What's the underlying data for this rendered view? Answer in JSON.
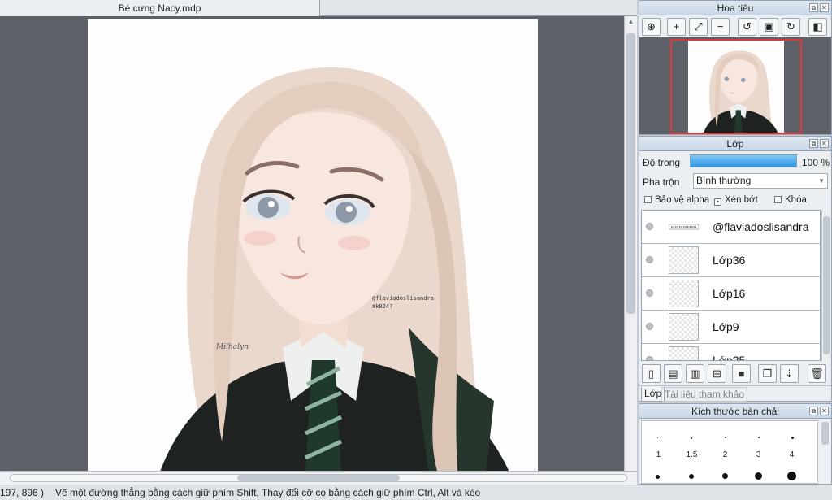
{
  "document": {
    "tab_title": "Bé cưng Nacy.mdp"
  },
  "artwork": {
    "watermark_line1": "@flaviadoslisandra",
    "watermark_line2": "#k824?",
    "signature": "Milhalyn"
  },
  "navigator": {
    "title": "Hoa tiêu",
    "tools": [
      "zoom-fit-icon",
      "zoom-in-icon",
      "fit-window-icon",
      "zoom-out-icon",
      "rotate-left-icon",
      "actual-size-icon",
      "rotate-right-icon",
      "flip-horizontal-icon"
    ]
  },
  "layers_panel": {
    "title": "Lớp",
    "opacity_label": "Độ trong",
    "opacity_value": "100 %",
    "opacity_fraction": 1.0,
    "blend_label": "Pha trộn",
    "blend_value": "Bình thường",
    "protect_alpha": "Bảo vệ alpha",
    "clipping": "Xén bớt",
    "lock": "Khóa",
    "layers": [
      {
        "name": "@flaviadoslisandra",
        "thumb": "text"
      },
      {
        "name": "Lớp36",
        "thumb": "empty"
      },
      {
        "name": "Lớp16",
        "thumb": "empty"
      },
      {
        "name": "Lớp9",
        "thumb": "empty"
      },
      {
        "name": "Lớp25",
        "thumb": "empty"
      }
    ],
    "tab_layer": "Lớp",
    "tab_reference": "Tài liệu tham khảo"
  },
  "brush_panel": {
    "title": "Kích thước bàn chải",
    "sizes": [
      "1",
      "1.5",
      "2",
      "3",
      "4"
    ]
  },
  "status": {
    "coords": "197, 896 )",
    "hint": "Vẽ một đường thẳng bằng cách giữ phím Shift, Thay đổi cỡ cọ bằng cách giữ phím Ctrl, Alt và kéo"
  },
  "colors": {
    "accent": "#2d97e4",
    "canvas_bg": "#5d6167",
    "nav_frame": "#d83a3a"
  }
}
